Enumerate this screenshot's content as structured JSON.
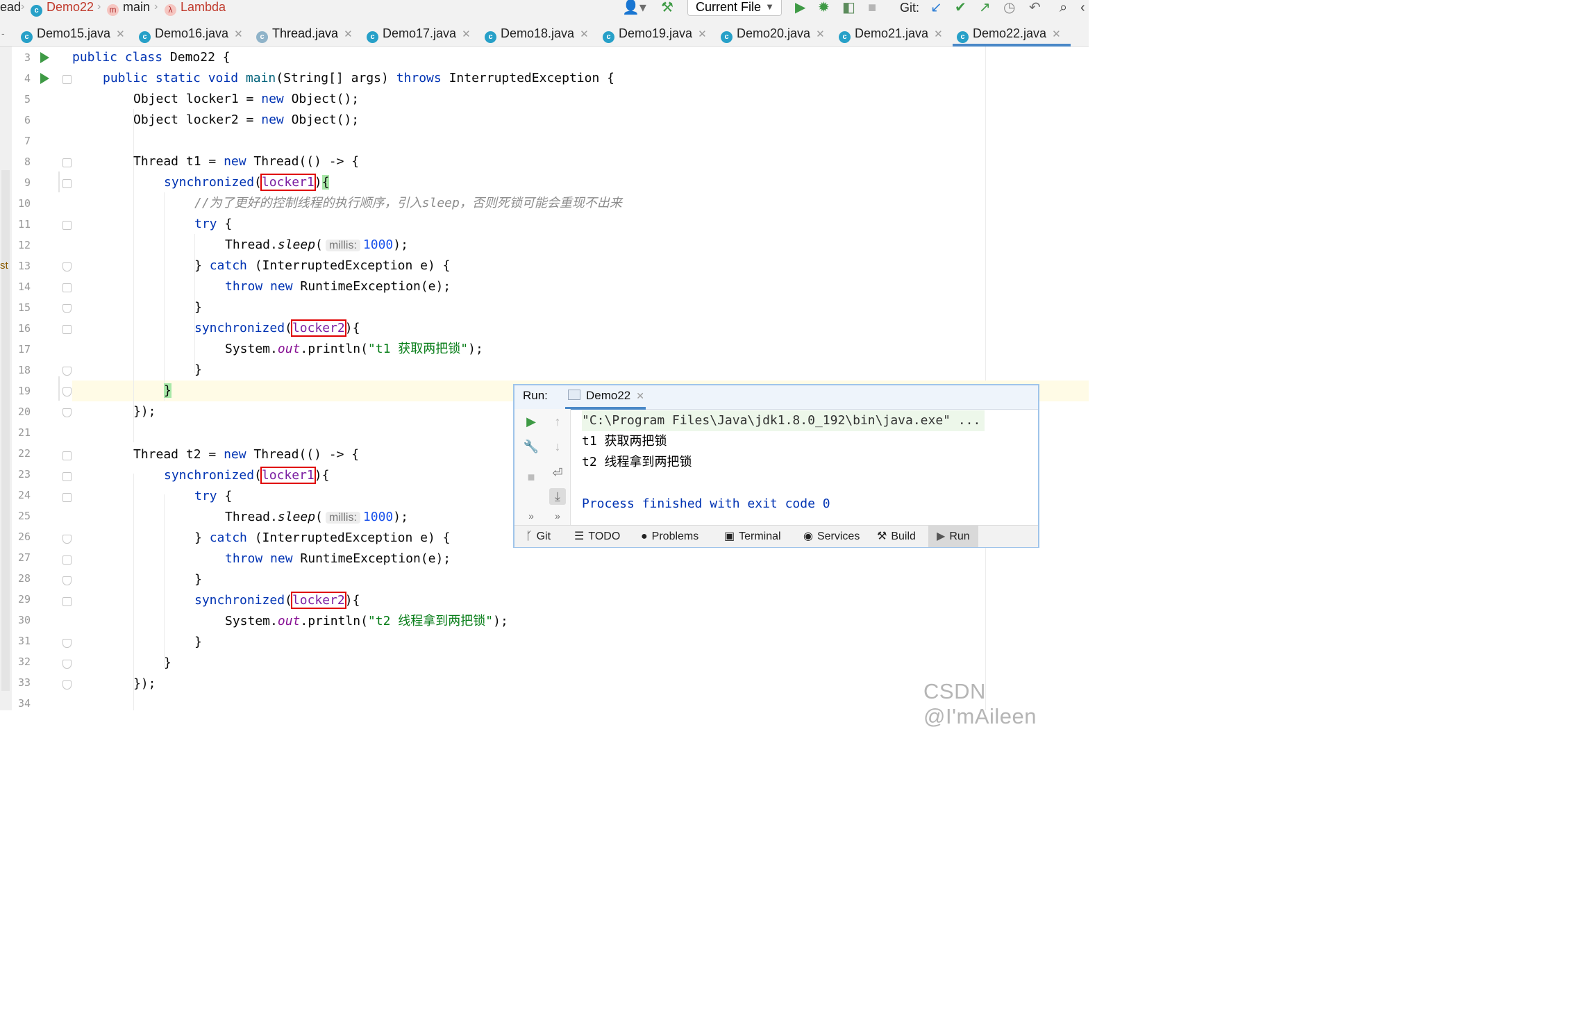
{
  "navbar": {
    "left_fragment": "ead",
    "crumbs": [
      "Demo22",
      "main",
      "Lambda"
    ],
    "run_config": "Current File",
    "git_label": "Git:"
  },
  "tabs": [
    {
      "label": "Demo15.java"
    },
    {
      "label": "Demo16.java"
    },
    {
      "label": "Thread.java"
    },
    {
      "label": "Demo17.java"
    },
    {
      "label": "Demo18.java"
    },
    {
      "label": "Demo19.java"
    },
    {
      "label": "Demo20.java"
    },
    {
      "label": "Demo21.java"
    },
    {
      "label": "Demo22.java",
      "active": true
    }
  ],
  "gutter": {
    "line_numbers": [
      "3",
      "4",
      "5",
      "6",
      "7",
      "8",
      "9",
      "10",
      "11",
      "12",
      "13",
      "14",
      "15",
      "16",
      "17",
      "18",
      "19",
      "20",
      "21",
      "22",
      "23",
      "24",
      "25",
      "26",
      "27",
      "28",
      "29",
      "30",
      "31",
      "32",
      "33",
      "34"
    ],
    "side_fragment": "st"
  },
  "code": {
    "l3": [
      "public class",
      "Demo22 {"
    ],
    "l4": [
      "public static void",
      "main",
      "(String[] args)",
      "throws",
      "InterruptedException {"
    ],
    "l5": [
      "Object locker1 =",
      "new",
      "Object();"
    ],
    "l6": [
      "Object locker2 =",
      "new",
      "Object();"
    ],
    "l8": [
      "Thread t1 =",
      "new",
      "Thread(() -> {"
    ],
    "l9": [
      "synchronized",
      "(",
      "locker1",
      ")",
      "{"
    ],
    "l10": "//为了更好的控制线程的执行顺序，引入sleep，否则死锁可能会重现不出来",
    "l11": [
      "try",
      "{"
    ],
    "l12": [
      "Thread.",
      "sleep",
      "(",
      "millis:",
      "1000",
      ");"
    ],
    "l13": [
      "}",
      "catch",
      "(InterruptedException e) {"
    ],
    "l14": [
      "throw",
      "new",
      "RuntimeException(e);"
    ],
    "l15": "}",
    "l16": [
      "synchronized",
      "(",
      "locker2",
      "){"
    ],
    "l17": [
      "System.",
      "out",
      ".println(",
      "\"t1 获取两把锁\"",
      ");"
    ],
    "l18": "}",
    "l19": "}",
    "l20": "});",
    "l22": [
      "Thread t2 =",
      "new",
      "Thread(() -> {"
    ],
    "l23": [
      "synchronized",
      "(",
      "locker1",
      ")",
      "{"
    ],
    "l24": [
      "try",
      "{"
    ],
    "l25": [
      "Thread.",
      "sleep",
      "(",
      "millis:",
      "1000",
      ");"
    ],
    "l26": [
      "}",
      "catch",
      "(InterruptedException e) {"
    ],
    "l27": [
      "throw",
      "new",
      "RuntimeException(e);"
    ],
    "l28": "}",
    "l29": [
      "synchronized",
      "(",
      "locker2",
      "){"
    ],
    "l30": [
      "System.",
      "out",
      ".println(",
      "\"t2 线程拿到两把锁\"",
      ");"
    ],
    "l31": "}",
    "l32": "}",
    "l33": "});"
  },
  "run_window": {
    "title": "Run:",
    "tab": "Demo22",
    "console": [
      "\"C:\\Program Files\\Java\\jdk1.8.0_192\\bin\\java.exe\" ...",
      "t1 获取两把锁",
      "t2 线程拿到两把锁",
      "",
      "Process finished with exit code 0"
    ],
    "bottom_tabs": [
      "Git",
      "TODO",
      "Problems",
      "Terminal",
      "Services",
      "Build",
      "Run"
    ]
  },
  "watermark": "CSDN @I'mAileen",
  "colors": {
    "keyword": "#0033b3",
    "string": "#067d17",
    "number": "#1750eb",
    "comment": "#8c8c8c",
    "field": "#871094",
    "highlight_box": "#e00000",
    "run_green": "#3e9a45",
    "tab_underline": "#4a88c7"
  }
}
